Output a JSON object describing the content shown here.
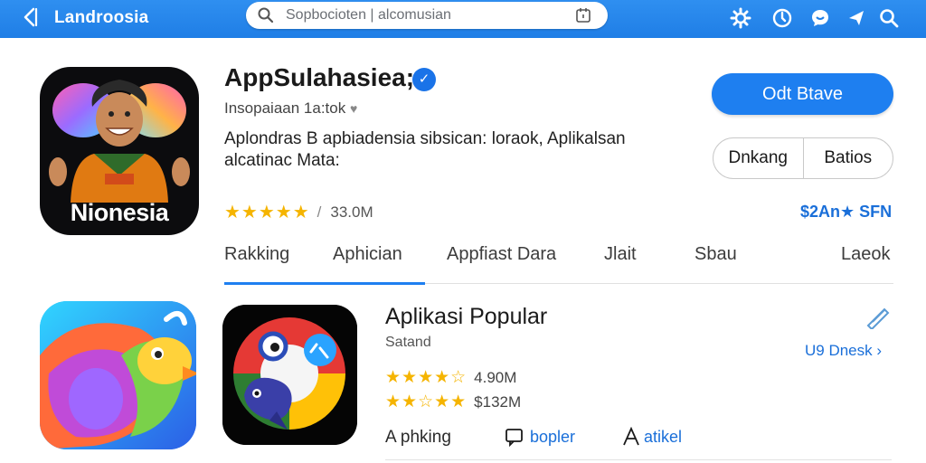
{
  "topbar": {
    "title": "Landroosia",
    "search_placeholder": "Sopbocioten | alcomusian",
    "colors": {
      "bar": "#1f7ee6",
      "accent": "#1e7ff0"
    },
    "icons": [
      "back-icon",
      "settings-icon",
      "clock-icon",
      "chat-icon",
      "send-icon",
      "search-icon"
    ]
  },
  "app": {
    "title": "AppSulahasiea;",
    "subtitle": "Insopaiaan  1a:tok",
    "description": "Aplondras B apbiadensia sibsican: loraok, Aplikalsan alcatinac Mata:",
    "icon_label": "Nionesia",
    "rating_sep": "/",
    "downloads": "33.0M",
    "install_label": "Odt Btave",
    "seg_left": "Dnkang",
    "seg_right": "Batios",
    "price": "$2An★ SFN"
  },
  "tabs": [
    "Rakking",
    "Aphician",
    "Appfiast Dara",
    "Jlait",
    "Sbau",
    "Laeok"
  ],
  "popular": {
    "title": "Aplikasi Popular",
    "subtitle": "Satand",
    "row1_value": "4.90M",
    "row2_value": "$132M",
    "see_more": "U9 Dnesk",
    "action1": "A phking",
    "action2": "bopler",
    "action3": "atikel"
  }
}
